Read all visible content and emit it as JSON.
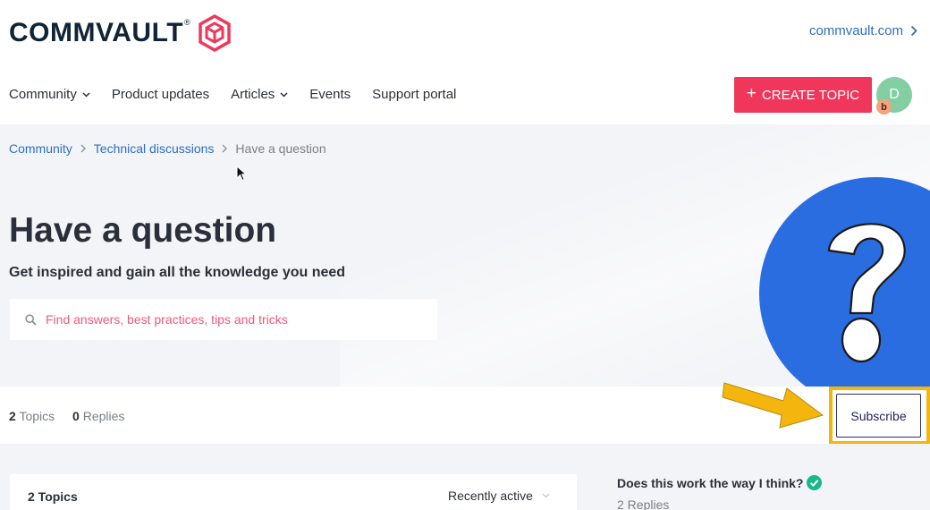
{
  "brand": {
    "name": "COMMVAULT",
    "tm": "®",
    "accent": "#f0365b",
    "link_color": "#2d6ec2"
  },
  "header": {
    "external_link": "commvault.com"
  },
  "nav": {
    "items": [
      {
        "label": "Community",
        "dropdown": true
      },
      {
        "label": "Product updates",
        "dropdown": false
      },
      {
        "label": "Articles",
        "dropdown": true
      },
      {
        "label": "Events",
        "dropdown": false
      },
      {
        "label": "Support portal",
        "dropdown": false
      }
    ],
    "create_button": "CREATE TOPIC",
    "avatar_initial": "D",
    "avatar_badge": "b"
  },
  "breadcrumb": [
    "Community",
    "Technical discussions",
    "Have a question"
  ],
  "hero": {
    "title": "Have a question",
    "subtitle": "Get inspired and gain all the knowledge you need",
    "search_placeholder": "Find answers, best practices, tips and tricks"
  },
  "stats": {
    "topics_count": "2",
    "topics_label": "Topics",
    "replies_count": "0",
    "replies_label": "Replies",
    "subscribe_label": "Subscribe",
    "highlight_color": "#f5b50f"
  },
  "topics_panel": {
    "count_label": "2 Topics",
    "sort_label": "Recently active"
  },
  "sidebar": {
    "topic_title": "Does this work the way I think?",
    "topic_replies": "2 Replies"
  }
}
